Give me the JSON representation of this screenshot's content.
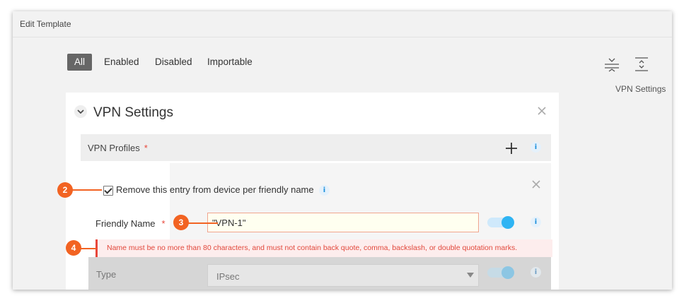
{
  "window": {
    "title": "Edit Template"
  },
  "filters": [
    "All",
    "Enabled",
    "Disabled",
    "Importable"
  ],
  "toolbar": {
    "side_label": "VPN Settings"
  },
  "panel": {
    "title": "VPN Settings",
    "profiles_label": "VPN Profiles",
    "required_mark": "*",
    "info_glyph": "i"
  },
  "entry": {
    "remove_label": "Remove this entry from device per friendly name",
    "remove_checked": true,
    "friendly_name_label": "Friendly Name",
    "friendly_name_value": "\"VPN-1\"",
    "friendly_name_toggle_on": true,
    "error_message": "Name must be no more than 80 characters, and must not contain back quote, comma, backslash, or double quotation marks.",
    "type_label": "Type",
    "type_value": "IPsec"
  },
  "callouts": [
    "2",
    "3",
    "4"
  ],
  "colors": {
    "accent": "#2fb4f3",
    "callout": "#f26322",
    "error": "#e2473b",
    "active_filter": "#666666"
  },
  "icons": [
    "collapse-rows-icon",
    "expand-rows-icon",
    "chevron-down-icon",
    "close-icon",
    "plus-icon",
    "info-icon"
  ]
}
